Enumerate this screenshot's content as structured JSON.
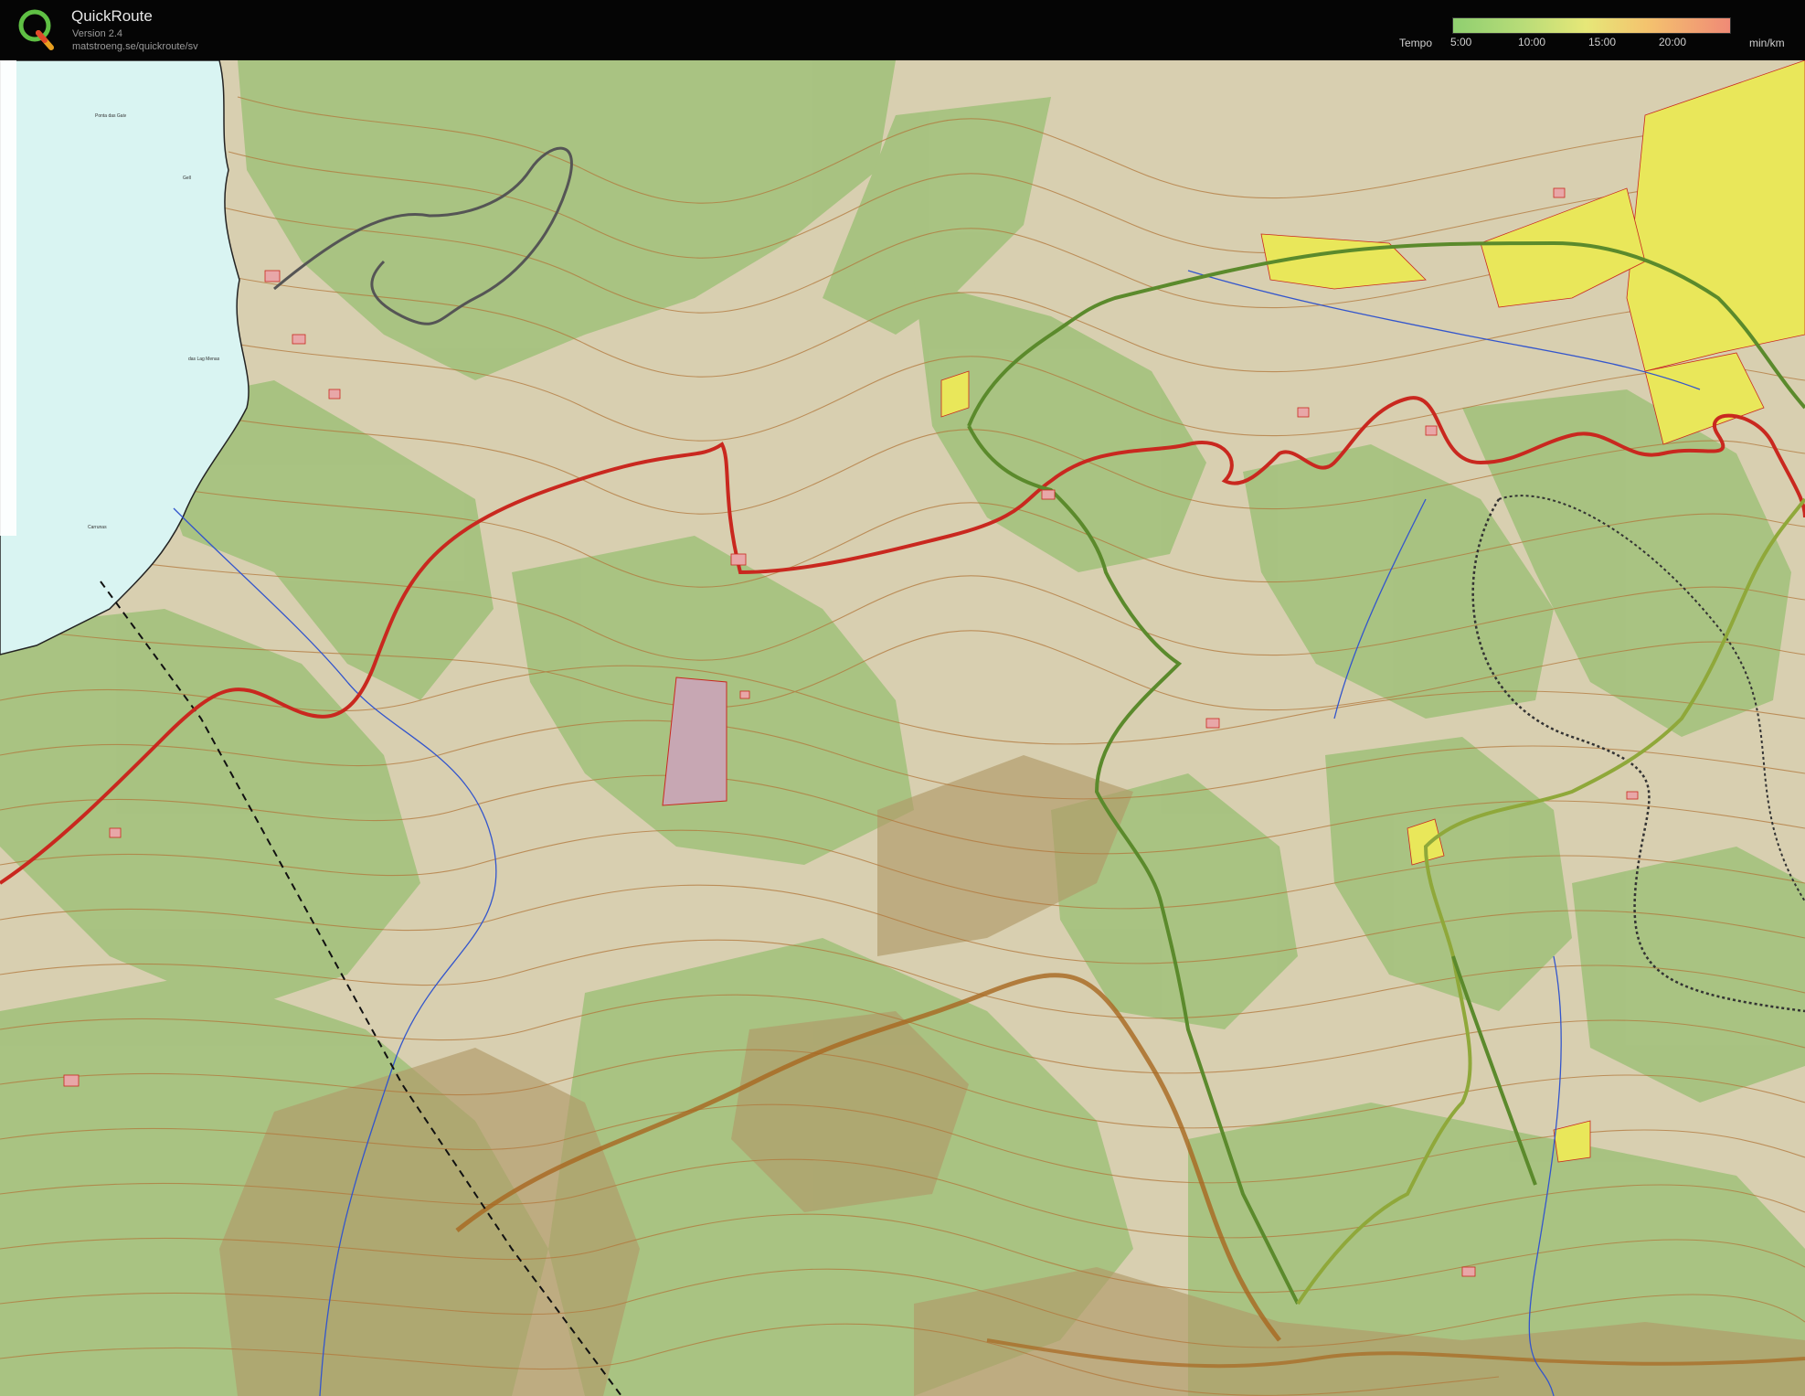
{
  "app": {
    "title": "QuickRoute",
    "version": "Version 2.4",
    "url": "matstroeng.se/quickroute/sv"
  },
  "legend": {
    "label": "Tempo",
    "ticks": [
      "5:00",
      "10:00",
      "15:00",
      "20:00"
    ],
    "unit": "min/km",
    "colors": [
      "#8fcf70",
      "#e6e778",
      "#f08a76"
    ]
  },
  "map": {
    "place_names": [
      "Ponta das Gaiv",
      "Gell",
      "das Lag Menas",
      "Carrunas"
    ],
    "colors": {
      "water": "#d9f4f2",
      "forest": "#a6c27f",
      "open_land": "#d8cfb0",
      "contour": "#b2773b",
      "road": "#c9281f",
      "route": "#5b8a2c",
      "settlement": "#e9e75a"
    }
  }
}
